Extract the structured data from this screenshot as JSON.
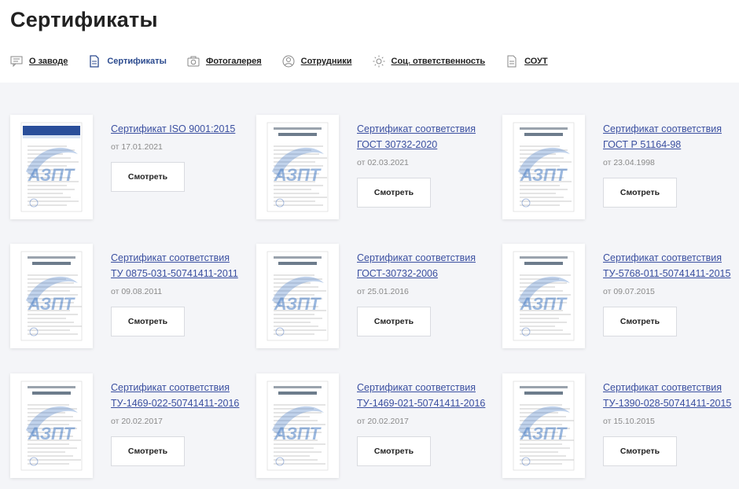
{
  "page": {
    "title": "Сертификаты"
  },
  "nav": [
    {
      "label": "О заводе",
      "icon": "chat-icon",
      "active": false
    },
    {
      "label": "Сертификаты",
      "icon": "document-icon",
      "active": true
    },
    {
      "label": "Фотогалерея",
      "icon": "camera-icon",
      "active": false
    },
    {
      "label": "Сотрудники",
      "icon": "user-icon",
      "active": false
    },
    {
      "label": "Соц. ответственность",
      "icon": "sun-icon",
      "active": false
    },
    {
      "label": "СОУТ",
      "icon": "file-icon",
      "active": false
    }
  ],
  "certificates": [
    {
      "title_line1": "Сертификат ISO 9001:2015",
      "title_line2": "",
      "date": "от 17.01.2021",
      "button": "Смотреть"
    },
    {
      "title_line1": "Сертификат соответствия",
      "title_line2": "ГОСТ 30732-2020",
      "date": "от 02.03.2021",
      "button": "Смотреть"
    },
    {
      "title_line1": "Сертификат соответствия",
      "title_line2": "ГОСТ Р 51164-98",
      "date": "от 23.04.1998",
      "button": "Смотреть"
    },
    {
      "title_line1": "Сертификат соответствия",
      "title_line2": "ТУ 0875-031-50741411-2011",
      "date": "от 09.08.2011",
      "button": "Смотреть"
    },
    {
      "title_line1": "Сертификат соответствия",
      "title_line2": "ГОСТ-30732-2006",
      "date": "от 25.01.2016",
      "button": "Смотреть"
    },
    {
      "title_line1": "Сертификат соответствия",
      "title_line2": "ТУ-5768-011-50741411-2015",
      "date": "от 09.07.2015",
      "button": "Смотреть"
    },
    {
      "title_line1": "Сертификат соответствия",
      "title_line2": "ТУ-1469-022-50741411-2016",
      "date": "от 20.02.2017",
      "button": "Смотреть"
    },
    {
      "title_line1": "Сертификат соответствия",
      "title_line2": "ТУ-1469-021-50741411-2016",
      "date": "от 20.02.2017",
      "button": "Смотреть"
    },
    {
      "title_line1": "Сертификат соответствия",
      "title_line2": "ТУ-1390-028-50741411-2015",
      "date": "от 15.10.2015",
      "button": "Смотреть"
    }
  ],
  "watermark": {
    "brand": "АЗПТ"
  },
  "colors": {
    "accent": "#2c4b8f",
    "link": "#3a4fa0",
    "panel_bg": "#f4f5f8",
    "watermark": "#4a7fc6"
  }
}
